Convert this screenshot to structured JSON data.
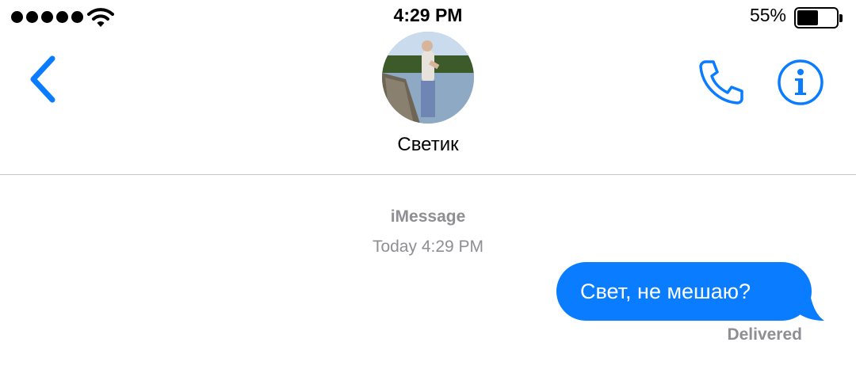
{
  "status_bar": {
    "time": "4:29 PM",
    "battery_percent_label": "55%",
    "battery_level": 0.55,
    "signal_bars": 5,
    "icons": [
      "signal-dots-icon",
      "wifi-icon",
      "battery-icon"
    ]
  },
  "header": {
    "contact_name": "Светик",
    "back_icon": "chevron-left-icon",
    "call_icon": "phone-icon",
    "info_icon": "info-icon",
    "accent_color": "#0a7cff"
  },
  "conversation": {
    "service_label": "iMessage",
    "timestamp": "Today 4:29 PM",
    "messages": [
      {
        "direction": "outgoing",
        "text": "Свет, не мешаю?",
        "bubble_color": "#0a7cff",
        "status": "Delivered"
      }
    ]
  }
}
